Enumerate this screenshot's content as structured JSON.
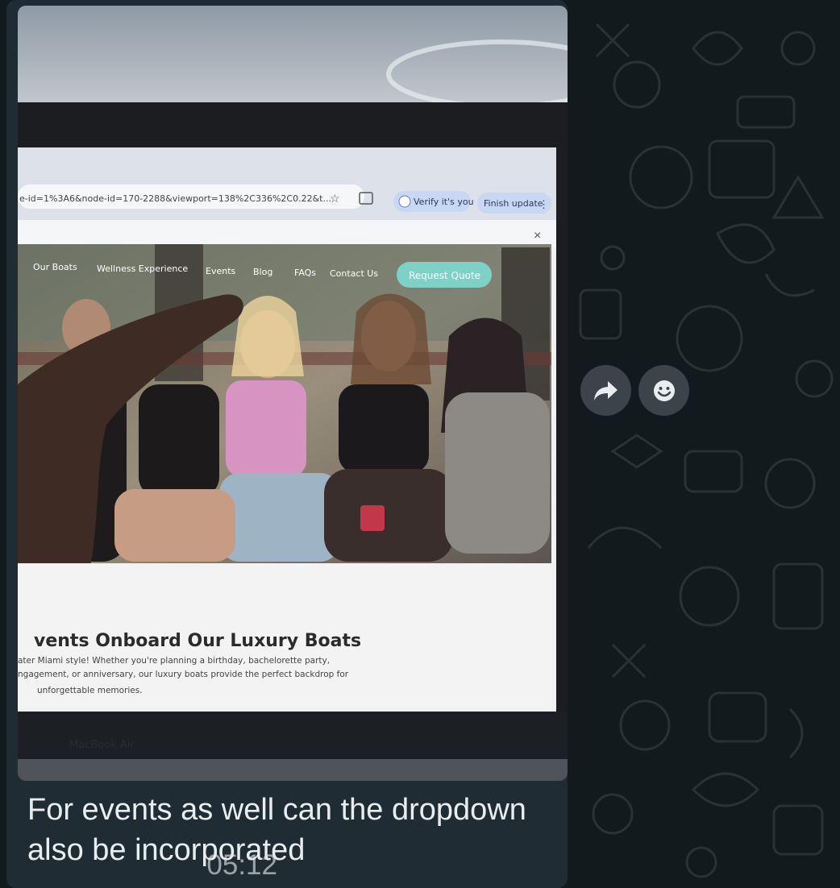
{
  "message": {
    "caption": "For events as well can the dropdown also be incorporated",
    "time": "05:12"
  },
  "photo": {
    "browser": {
      "url_fragment": "e-id=1%3A6&node-id=170-2288&viewport=138%2C336%2C0.22&t...",
      "verify_label": "Verify it's you",
      "finish_update_label": "Finish update"
    },
    "site": {
      "nav_items": [
        "Our Boats",
        "Wellness Experience",
        "Events",
        "Blog",
        "FAQs",
        "Contact Us"
      ],
      "cta_label": "Request Quote",
      "heading": "vents Onboard Our Luxury Boats",
      "body_line1": "ater Miami style! Whether you're planning a birthday,  bachelorette party,",
      "body_line2": "ngagement, or anniversary,  our luxury boats provide the perfect backdrop for",
      "body_line3": "unforgettable memories.",
      "close_glyph": "×"
    },
    "laptop_label": "MacBook Air"
  },
  "actions": {
    "forward_icon": "forward-icon",
    "react_icon": "emoji-icon"
  }
}
